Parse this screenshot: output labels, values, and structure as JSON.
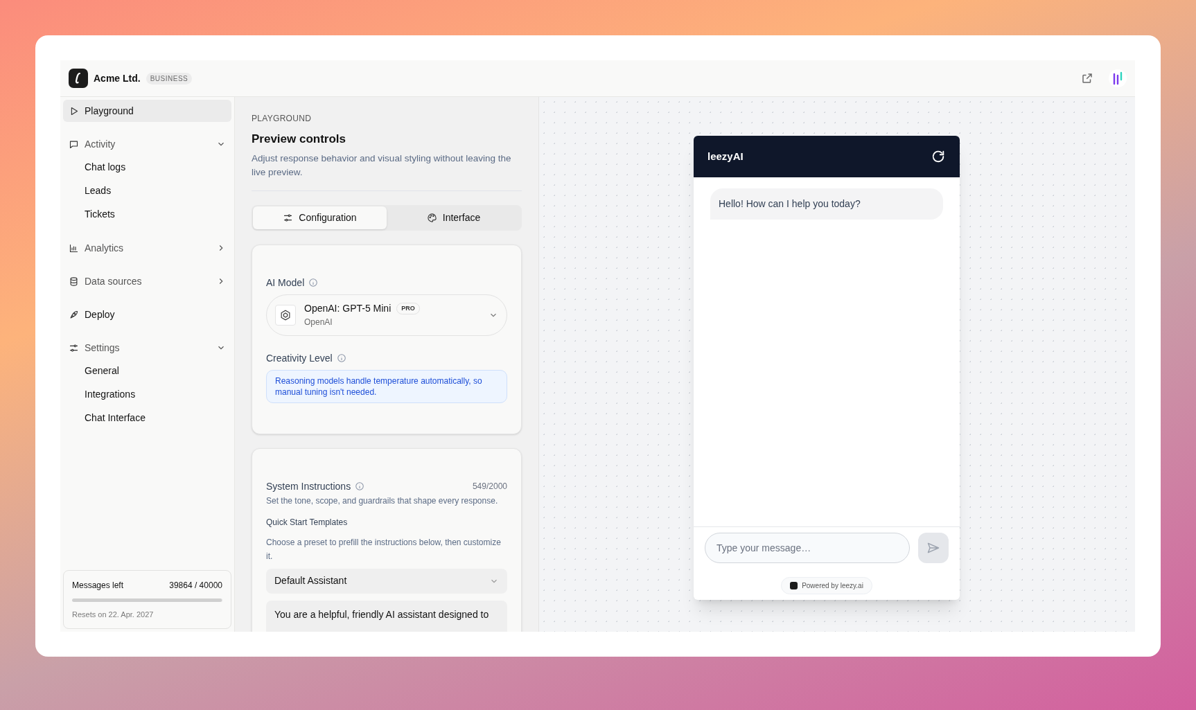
{
  "header": {
    "org_name": "Acme Ltd.",
    "plan_badge": "BUSINESS"
  },
  "sidebar": {
    "items": [
      {
        "kind": "link",
        "label": "Playground",
        "selected": true
      },
      {
        "kind": "group",
        "label": "Activity",
        "expanded": true,
        "children": [
          {
            "label": "Chat logs"
          },
          {
            "label": "Leads"
          },
          {
            "label": "Tickets"
          }
        ]
      },
      {
        "kind": "group",
        "label": "Analytics",
        "expanded": false
      },
      {
        "kind": "group",
        "label": "Data sources",
        "expanded": false
      },
      {
        "kind": "link",
        "label": "Deploy",
        "selected": false
      },
      {
        "kind": "group",
        "label": "Settings",
        "expanded": true,
        "children": [
          {
            "label": "General"
          },
          {
            "label": "Integrations"
          },
          {
            "label": "Chat Interface"
          }
        ]
      }
    ],
    "usage": {
      "label": "Messages left",
      "count": "39864 / 40000",
      "level": 0.9966,
      "reset_note": "Resets on 22. Apr. 2027"
    }
  },
  "panel": {
    "eyebrow": "PLAYGROUND",
    "title": "Preview controls",
    "description": "Adjust response behavior and visual styling without leaving the live preview.",
    "tabs": [
      {
        "label": "Configuration",
        "selected": true
      },
      {
        "label": "Interface",
        "selected": false
      }
    ],
    "model_card": {
      "label": "AI Model",
      "model_name": "OpenAI: GPT-5 Mini",
      "model_badge": "PRO",
      "provider": "OpenAI",
      "creativity_label": "Creativity Level",
      "creativity_note": "Reasoning models handle temperature automatically, so manual tuning isn't needed."
    },
    "instructions_card": {
      "label": "System Instructions",
      "counter": "549/2000",
      "hint": "Set the tone, scope, and guardrails that shape every response.",
      "templates_label": "Quick Start Templates",
      "templates_hint": "Choose a preset to prefill the instructions below, then customize it.",
      "template_value": "Default Assistant",
      "instructions_text": "You are a helpful, friendly AI assistant designed to"
    }
  },
  "chat_preview": {
    "title": "leezyAI",
    "messages": [
      {
        "text": "Hello! How can I help you today?"
      }
    ],
    "input_placeholder": "Type your message…",
    "powered_by": "Powered by leezy.ai"
  }
}
